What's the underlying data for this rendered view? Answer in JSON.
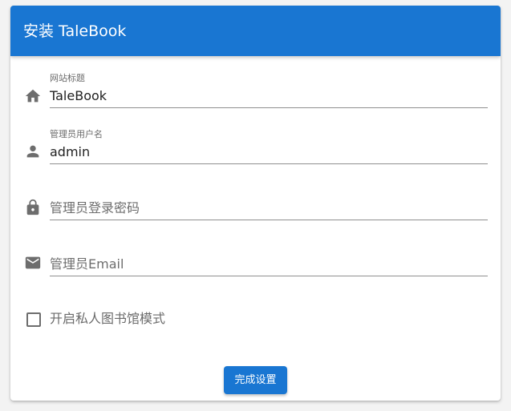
{
  "header": {
    "title": "安装 TaleBook"
  },
  "form": {
    "site_title": {
      "label": "网站标题",
      "value": "TaleBook",
      "icon": "home-icon"
    },
    "admin_username": {
      "label": "管理员用户名",
      "value": "admin",
      "icon": "person-icon"
    },
    "admin_password": {
      "placeholder": "管理员登录密码",
      "value": "",
      "icon": "lock-icon"
    },
    "admin_email": {
      "placeholder": "管理员Email",
      "value": "",
      "icon": "email-icon"
    },
    "private_mode": {
      "label": "开启私人图书馆模式",
      "checked": false
    },
    "submit_label": "完成设置"
  },
  "colors": {
    "primary": "#1976d2",
    "icon": "#6d6d6d",
    "underline": "#8f8f8f"
  }
}
